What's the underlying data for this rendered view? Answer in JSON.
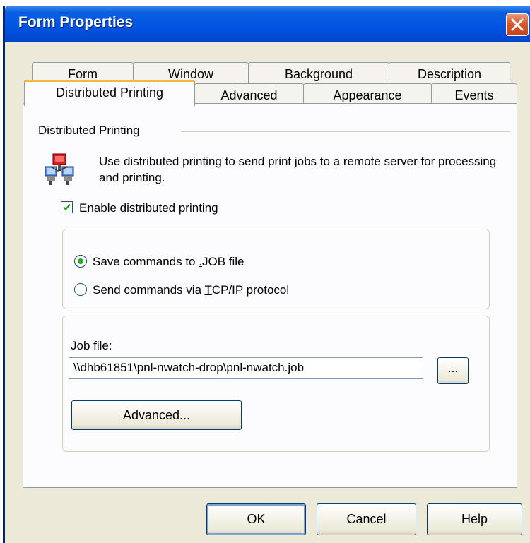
{
  "window": {
    "title": "Form Properties"
  },
  "tabs": {
    "back_row": [
      {
        "label": "Form"
      },
      {
        "label": "Window"
      },
      {
        "label": "Background"
      },
      {
        "label": "Description"
      }
    ],
    "front_row": [
      {
        "label": "Distributed Printing",
        "active": true
      },
      {
        "label": "Advanced"
      },
      {
        "label": "Appearance"
      },
      {
        "label": "Events"
      }
    ]
  },
  "group": {
    "title": "Distributed Printing",
    "description": "Use distributed printing to send print jobs to a remote server for processing and printing.",
    "icon": "network-printer-icon"
  },
  "enable": {
    "checked": true,
    "pre": "Enable ",
    "accel": "d",
    "post": "istributed printing"
  },
  "mode": {
    "options": [
      {
        "pre": "Save commands to ",
        "accel": ".",
        "post": "JOB file",
        "selected": true
      },
      {
        "pre": "Send commands via ",
        "accel": "T",
        "post": "CP/IP protocol",
        "selected": false
      }
    ]
  },
  "job": {
    "label": "Job file:",
    "value": "\\\\dhb61851\\pnl-nwatch-drop\\pnl-nwatch.job",
    "browse_label": "...",
    "advanced_label": "Advanced..."
  },
  "footer": {
    "ok": "OK",
    "cancel": "Cancel",
    "help": "Help"
  },
  "colors": {
    "titlebar": "#0054e3",
    "dialog_bg": "#ece9d8",
    "active_tab_accent": "#f4b73a",
    "radio_selected": "#2ea62e"
  }
}
